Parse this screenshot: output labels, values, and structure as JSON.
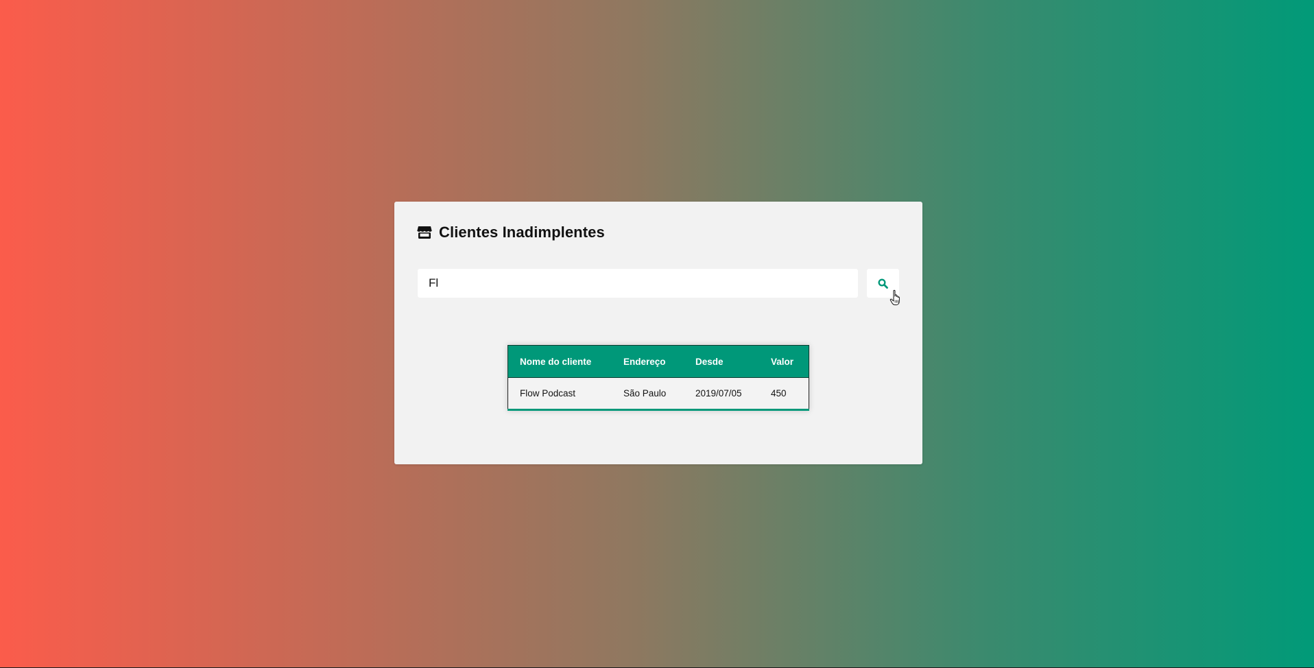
{
  "page": {
    "title": "Clientes Inadimplentes"
  },
  "search": {
    "value": "Fl",
    "button_icon": "search-icon"
  },
  "table": {
    "headers": [
      "Nome do cliente",
      "Endereço",
      "Desde",
      "Valor"
    ],
    "rows": [
      [
        "Flow Podcast",
        "São Paulo",
        "2019/07/05",
        "450"
      ]
    ]
  },
  "colors": {
    "accent": "#009879",
    "card_bg": "#f2f2f2",
    "gradient_left": "#fb5c4b",
    "gradient_right": "#019a78"
  },
  "icons": {
    "title_icon": "store-icon",
    "cursor": "hand-pointer-icon"
  }
}
